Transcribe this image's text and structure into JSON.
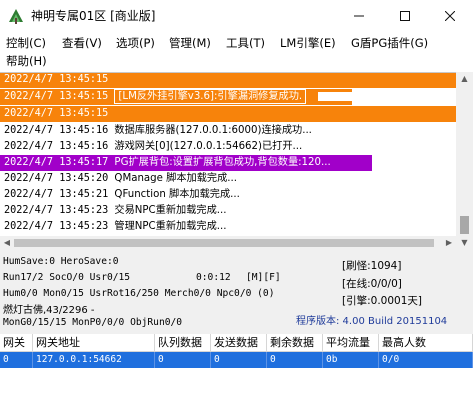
{
  "window": {
    "title": "神明专属01区 [商业版]",
    "controls": [
      "minimize",
      "maximize",
      "close"
    ]
  },
  "menu": [
    "控制(C)",
    "查看(V)",
    "选项(P)",
    "管理(M)",
    "工具(T)",
    "LM引擎(E)",
    "G盾PG插件(G)",
    "帮助(H)"
  ],
  "log": [
    {
      "time": "2022/4/7 13:45:15",
      "text": "",
      "style": "orange"
    },
    {
      "time": "2022/4/7 13:45:15",
      "text": "[LM反外挂引擎v3.6]:引擎漏洞修复成功.",
      "style": "orange"
    },
    {
      "time": "2022/4/7 13:45:15",
      "text": "",
      "style": "orange"
    },
    {
      "time": "2022/4/7 13:45:16",
      "text": "数据库服务器(127.0.0.1:6000)连接成功...",
      "style": "plain"
    },
    {
      "time": "2022/4/7 13:45:16",
      "text": "游戏网关[0](127.0.0.1:54662)已打开...",
      "style": "plain"
    },
    {
      "time": "2022/4/7 13:45:17",
      "text": "PG扩展背包:设置扩展背包成功,背包数量:120...",
      "style": "purple"
    },
    {
      "time": "2022/4/7 13:45:20",
      "text": "QManage 脚本加载完成...",
      "style": "plain"
    },
    {
      "time": "2022/4/7 13:45:21",
      "text": "QFunction 脚本加载完成...",
      "style": "plain"
    },
    {
      "time": "2022/4/7 13:45:23",
      "text": "交易NPC重新加载完成...",
      "style": "plain"
    },
    {
      "time": "2022/4/7 13:45:23",
      "text": "管理NPC重新加载完成...",
      "style": "plain"
    }
  ],
  "status": {
    "line1": "HumSave:0 HeroSave:0",
    "line2": "Run17/2 SocO/0 Usr0/15",
    "clock": "0:0:12",
    "flags": "[M][F]",
    "line3": "Hum0/0 Mon0/15 UsrRot16/250 Merch0/0 Npc0/0 (0)",
    "line4": "燃灯古佛,43/2296 -",
    "line5": "MonG0/15/15 MonP0/0/0 ObjRun0/0",
    "refresh": "[刷怪:1094]",
    "online": "[在线:0/0/0]",
    "engine": "[引擎:0.0001天]",
    "version": "程序版本: 4.00 Build 20151104"
  },
  "table": {
    "columns": [
      "网关",
      "网关地址",
      "队列数据",
      "发送数据",
      "剩余数据",
      "平均流量",
      "最高人数"
    ],
    "rows": [
      [
        "0",
        "127.0.0.1:54662",
        "0",
        "0",
        "0",
        "0b",
        "0/0"
      ]
    ]
  },
  "colors": {
    "orange": "#f7830b",
    "purple": "#a100c9",
    "selection": "#1f6fde",
    "version": "#1f3b9a"
  }
}
